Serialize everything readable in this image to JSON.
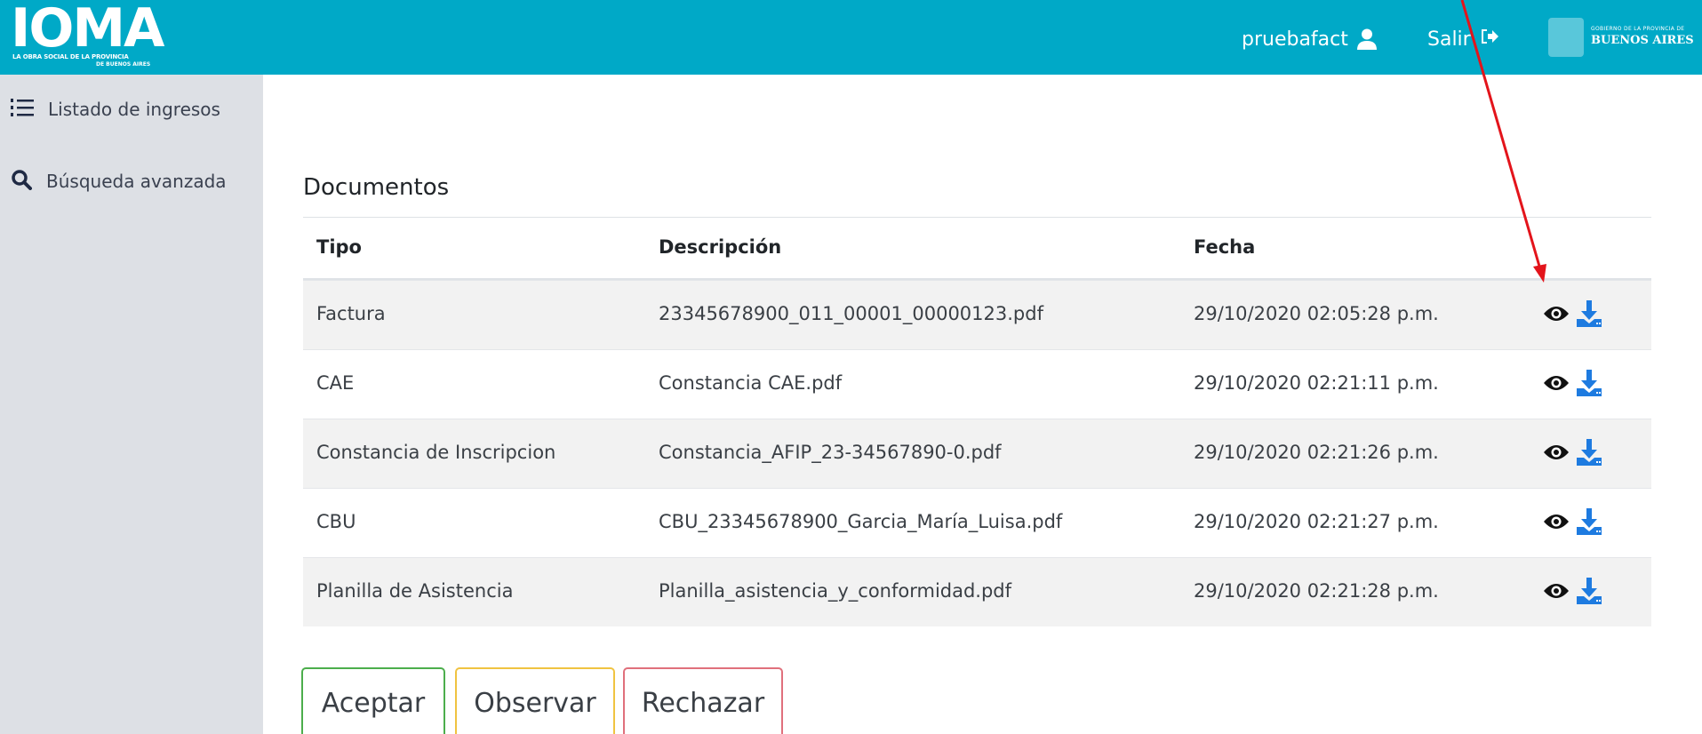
{
  "header": {
    "logo_title": "IOMA",
    "logo_subtitle_1": "LA OBRA SOCIAL DE LA PROVINCIA",
    "logo_subtitle_2": "DE BUENOS AIRES",
    "username": "pruebafact",
    "logout_label": "Salir",
    "gov_logo_line1": "GOBIERNO DE LA PROVINCIA DE",
    "gov_logo_line2": "BUENOS AIRES",
    "bg_color": "#00a9c7"
  },
  "sidebar": {
    "items": [
      {
        "label": "Listado de ingresos",
        "icon": "list-icon"
      },
      {
        "label": "Búsqueda avanzada",
        "icon": "search-icon"
      }
    ]
  },
  "main": {
    "title": "Documentos",
    "columns": [
      "Tipo",
      "Descripción",
      "Fecha"
    ],
    "rows": [
      {
        "tipo": "Factura",
        "descripcion": "23345678900_011_00001_00000123.pdf",
        "fecha": "29/10/2020 02:05:28 p.m."
      },
      {
        "tipo": "CAE",
        "descripcion": "Constancia CAE.pdf",
        "fecha": "29/10/2020 02:21:11 p.m."
      },
      {
        "tipo": "Constancia de Inscripcion",
        "descripcion": "Constancia_AFIP_23-34567890-0.pdf",
        "fecha": "29/10/2020 02:21:26 p.m."
      },
      {
        "tipo": "CBU",
        "descripcion": "CBU_23345678900_Garcia_María_Luisa.pdf",
        "fecha": "29/10/2020 02:21:27 p.m."
      },
      {
        "tipo": "Planilla de Asistencia",
        "descripcion": "Planilla_asistencia_y_conformidad.pdf",
        "fecha": "29/10/2020 02:21:28 p.m."
      }
    ],
    "row_actions": [
      "eye-icon",
      "download-icon"
    ]
  },
  "buttons": {
    "accept": "Aceptar",
    "observe": "Observar",
    "reject": "Rechazar"
  },
  "colors": {
    "accent": "#00a9c7",
    "download_blue": "#1e7be0",
    "accept_border": "#4cae4c",
    "observe_border": "#f0c341",
    "reject_border": "#e0707c",
    "annotation_arrow": "#e3141b"
  }
}
